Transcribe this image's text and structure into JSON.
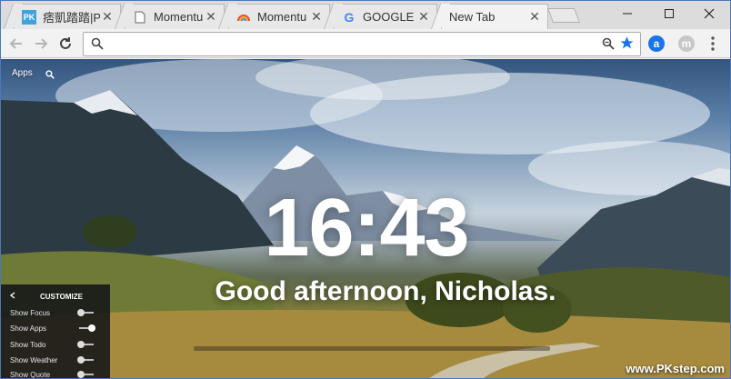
{
  "tabs": [
    {
      "title": "痞凱踏踏|P",
      "favicon": "pk-logo"
    },
    {
      "title": "Momentu",
      "favicon": "page-icon"
    },
    {
      "title": "Momentu",
      "favicon": "rainbow-icon"
    },
    {
      "title": "GOOGLE",
      "favicon": "google-icon"
    },
    {
      "title": "New Tab",
      "favicon": "none",
      "active": true
    }
  ],
  "favicon_text": {
    "pk": "PK",
    "google": "G"
  },
  "toolbar": {
    "ext1": "a",
    "ext2": "m"
  },
  "omnibox": {
    "value": "",
    "placeholder": ""
  },
  "content": {
    "apps_label": "Apps",
    "time": "16:43",
    "greeting": "Good afternoon, Nicholas."
  },
  "customize": {
    "title": "CUSTOMIZE",
    "rows": [
      {
        "label": "Show Focus",
        "on": false
      },
      {
        "label": "Show Apps",
        "on": true
      },
      {
        "label": "Show Todo",
        "on": false
      },
      {
        "label": "Show Weather",
        "on": false
      },
      {
        "label": "Show Quote",
        "on": false
      }
    ]
  },
  "watermark": "www.PKstep.com",
  "colors": {
    "accent": "#1a73e8",
    "pk": "#3ea4dc",
    "window_border": "#4a78b8"
  }
}
